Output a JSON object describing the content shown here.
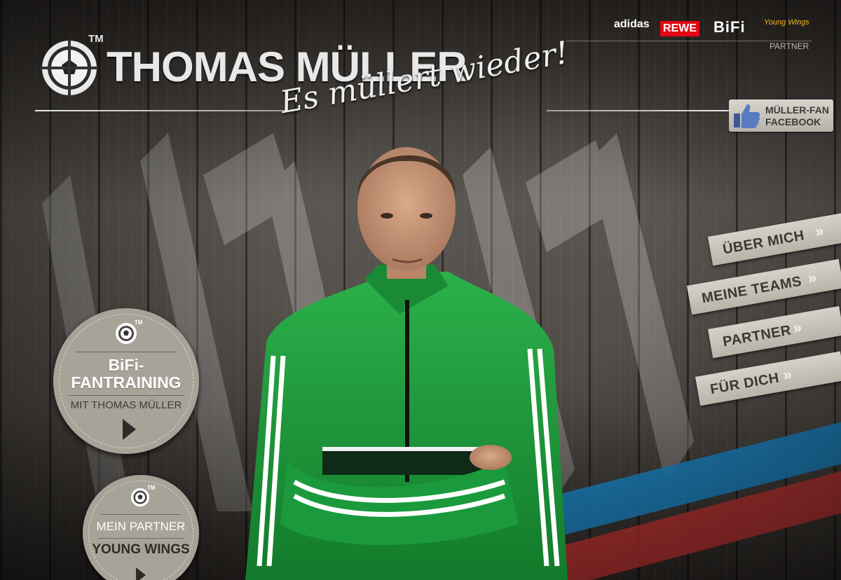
{
  "brand": {
    "trademark": "TM",
    "name": "THOMAS MÜLLER",
    "slogan": "Es müllert wieder!"
  },
  "sponsors": {
    "items": [
      "adidas",
      "REWE",
      "BiFi",
      "Young Wings"
    ],
    "label": "PARTNER"
  },
  "facebook": {
    "line1": "MÜLLER-FAN",
    "line2": "FACEBOOK"
  },
  "nav": {
    "items": [
      {
        "label": "ÜBER MICH",
        "chevron": "»"
      },
      {
        "label": "MEINE TEAMS",
        "chevron": "»"
      },
      {
        "label": "PARTNER",
        "chevron": "»"
      },
      {
        "label": "FÜR DICH",
        "chevron": "»"
      }
    ]
  },
  "badges": {
    "fantraining": {
      "trademark": "TM",
      "title_line1": "BiFi-",
      "title_line2": "FANTRAINING",
      "subtitle": "MIT THOMAS MÜLLER",
      "icon": "play-icon"
    },
    "partner": {
      "trademark": "TM",
      "subtitle": "MEIN PARTNER",
      "title": "YOUNG WINGS",
      "icon": "play-icon"
    }
  },
  "colors": {
    "jacket_green": "#1e9a3a",
    "stripe_blue": "#1b84c2",
    "stripe_red": "#c23232",
    "badge_bg": "#a8a398",
    "nav_bg": "#d6d2c9"
  }
}
